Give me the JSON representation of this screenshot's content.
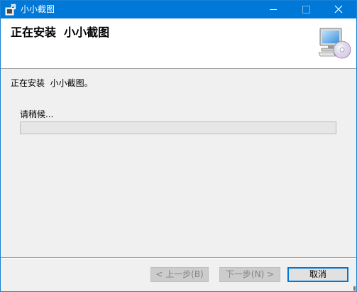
{
  "window": {
    "title": "小小截图",
    "icon": "installer-icon",
    "controls": {
      "minimize_icon": "minimize-icon",
      "maximize_icon": "maximize-icon",
      "close_icon": "close-icon"
    }
  },
  "banner": {
    "title": "正在安装  小小截图",
    "icon": "computer-cd-icon"
  },
  "body": {
    "status": "正在安装  小小截图。",
    "wait_label": "请稍候...",
    "progress": 0
  },
  "footer": {
    "back_label": "< 上一步(B)",
    "next_label": "下一步(N) >",
    "cancel_label": "取消"
  },
  "colors": {
    "titlebar": "#0078d7",
    "accent": "#0078d7",
    "window_bg": "#f0f0f0",
    "progress_fill": "#06b025"
  }
}
